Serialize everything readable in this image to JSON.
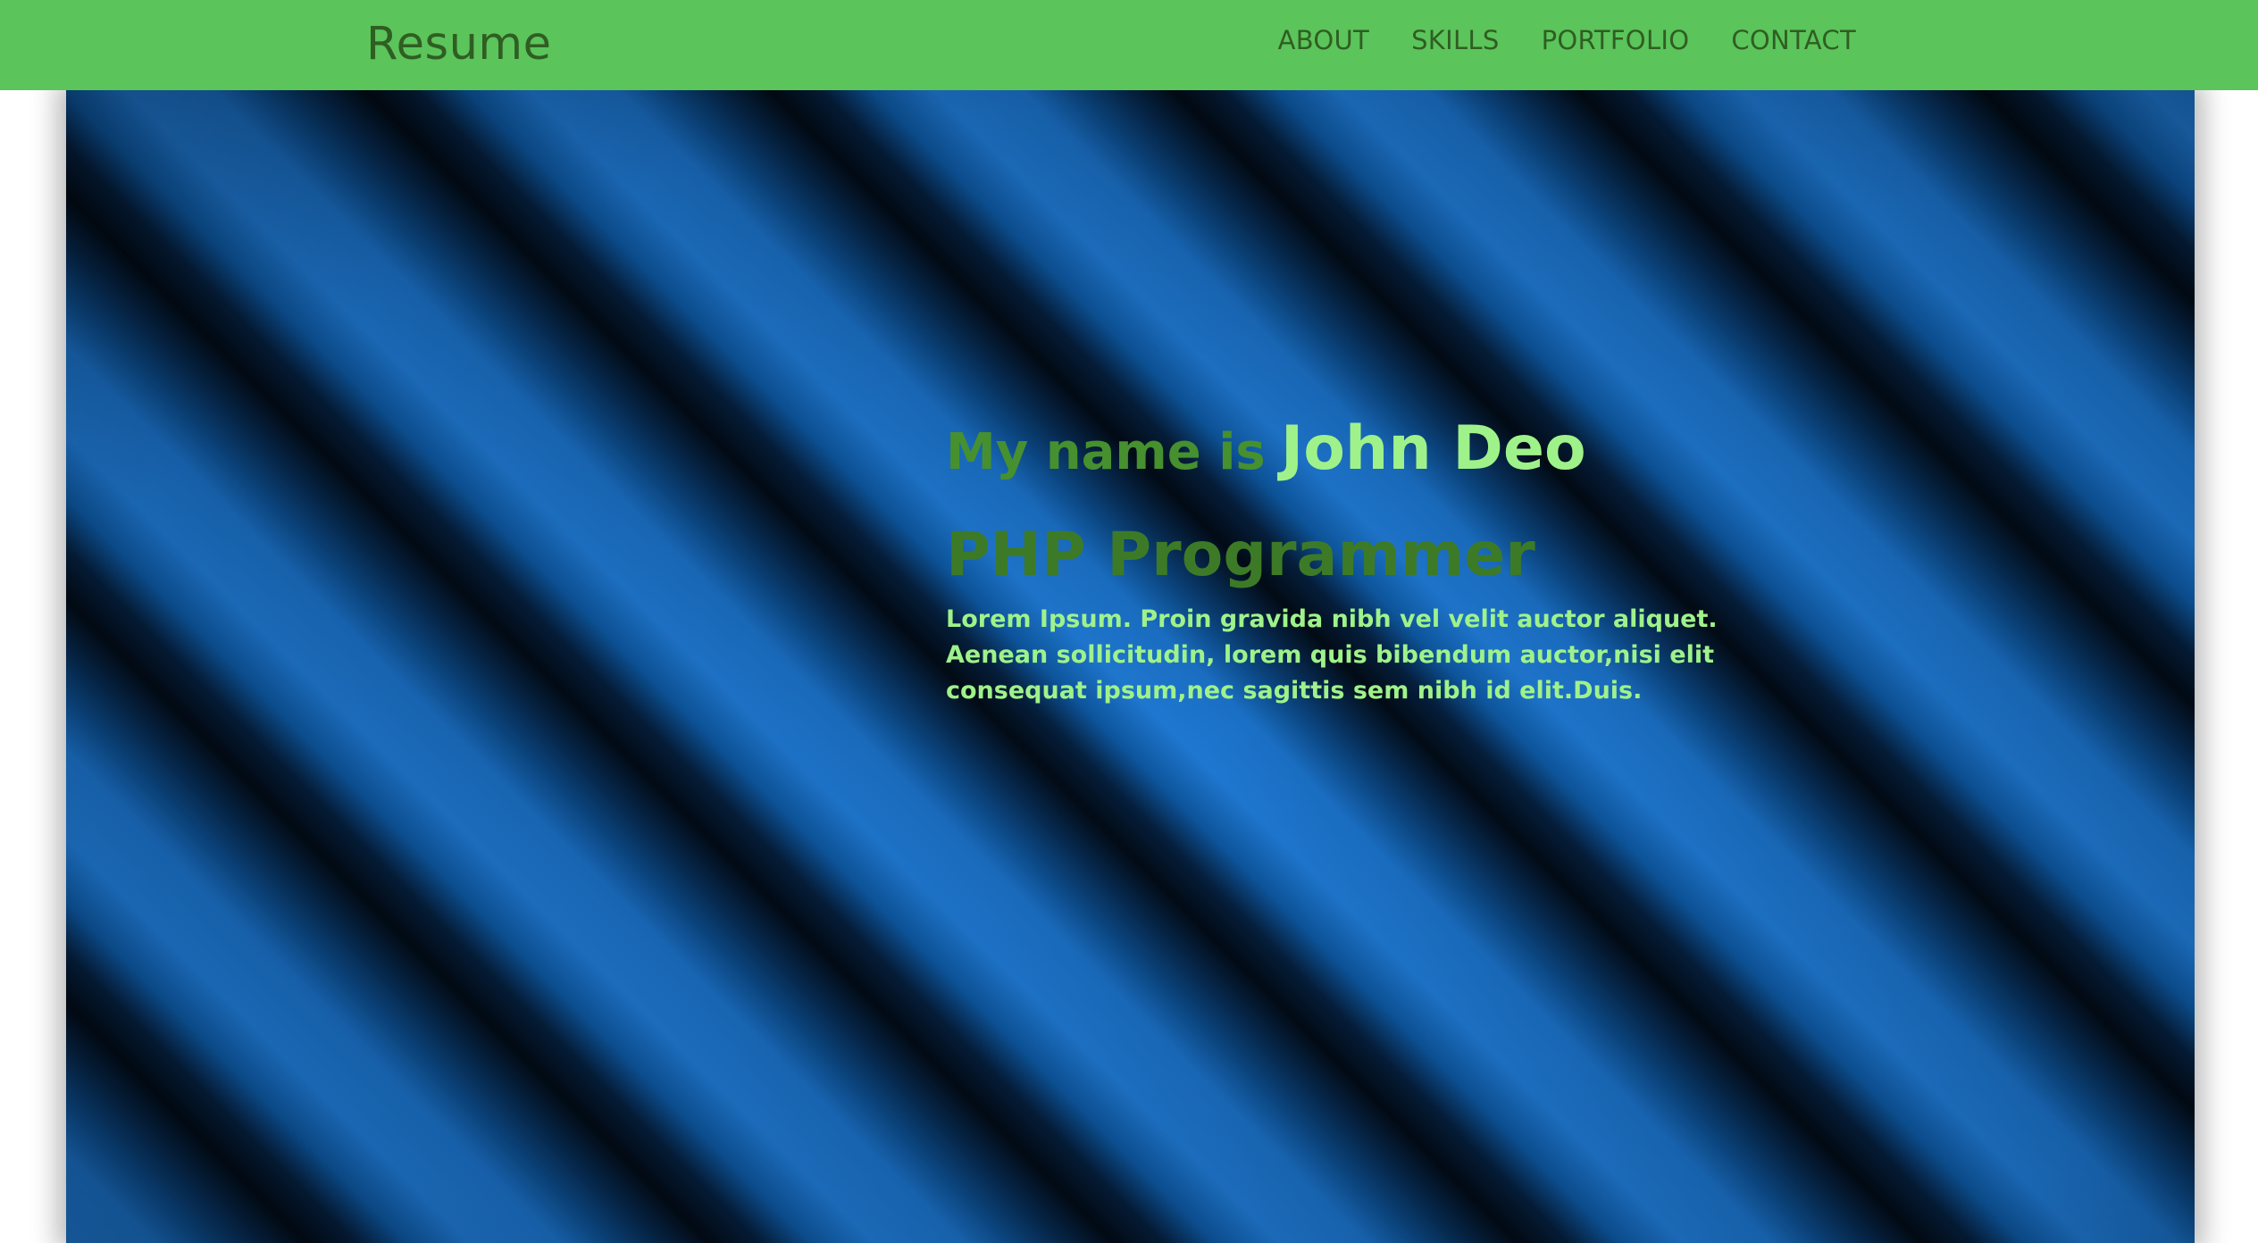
{
  "navbar": {
    "brand": "Resume",
    "links": [
      "ABOUT",
      "SKILLS",
      "PORTFOLIO",
      "CONTACT"
    ],
    "background_color": "#5bc45b",
    "text_color": "#2f5e22"
  },
  "hero": {
    "intro_prefix": "My name is",
    "name": "John Deo",
    "role": "PHP Programmer",
    "bio": "Lorem Ipsum. Proin gravida nibh vel velit auctor aliquet. Aenean sollicitudin, lorem quis bibendum auctor,nisi elit consequat ipsum,nec sagittis sem nibh id elit.Duis.",
    "name_color": "#9ff28a",
    "role_color": "#3d7a27",
    "background": "blue diagonal stripes"
  }
}
